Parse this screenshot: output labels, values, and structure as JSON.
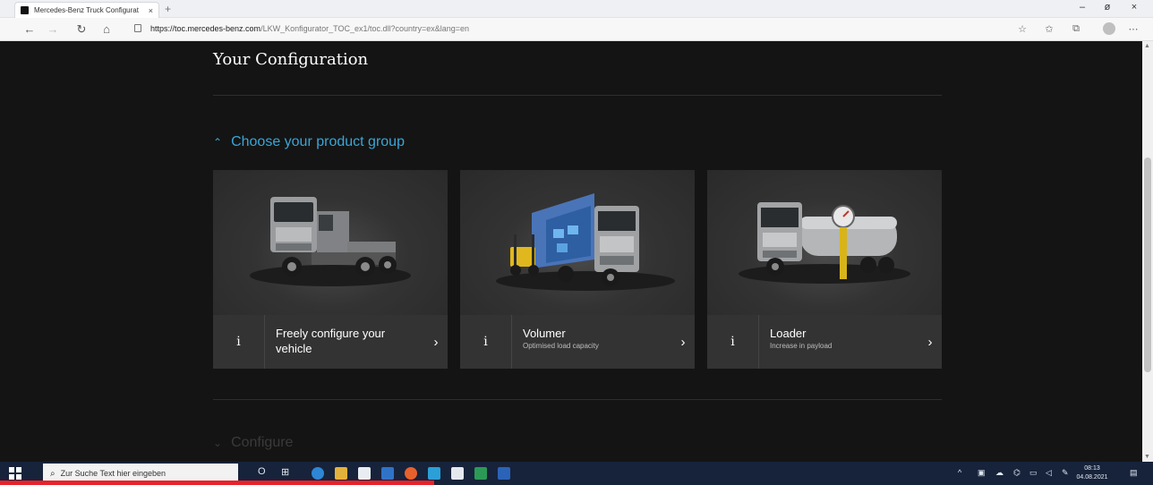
{
  "browser": {
    "tab_title": "Mercedes-Benz Truck Configurat",
    "tab_close": "×",
    "new_tab": "+",
    "url_host": "https://toc.mercedes-benz.com",
    "url_path": "/LKW_Konfigurator_TOC_ex1/toc.dll?country=ex&lang=en",
    "window_controls": [
      "–",
      "ø",
      "×"
    ]
  },
  "page": {
    "title": "Your Configuration",
    "accent_color": "#3aa6d6",
    "sections": [
      {
        "label": "Choose your product group",
        "state": "expanded"
      },
      {
        "label": "Configure",
        "state": "collapsed"
      }
    ],
    "cards": [
      {
        "title": "Freely configure your vehicle",
        "subtitle": "",
        "info": "i",
        "arrow": "›",
        "image": "tractor-truck"
      },
      {
        "title": "Volumer",
        "subtitle": "Optimised load capacity",
        "info": "i",
        "arrow": "›",
        "image": "box-truck-with-forklift"
      },
      {
        "title": "Loader",
        "subtitle": "Increase in payload",
        "info": "i",
        "arrow": "›",
        "image": "tanker-truck"
      }
    ]
  },
  "taskbar": {
    "search_placeholder": "Zur Suche Text hier eingeben",
    "clock_time": "08:13",
    "clock_date": "04.08.2021",
    "task_view_icon": "O",
    "multitask_icon": "⊞"
  }
}
